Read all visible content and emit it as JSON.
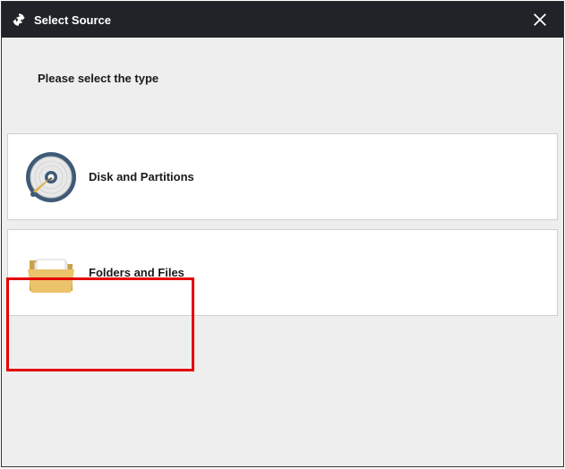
{
  "titlebar": {
    "title": "Select Source"
  },
  "instruction_text": "Please select the type",
  "options": {
    "disk": {
      "label": "Disk and Partitions"
    },
    "folders": {
      "label": "Folders and Files"
    }
  }
}
